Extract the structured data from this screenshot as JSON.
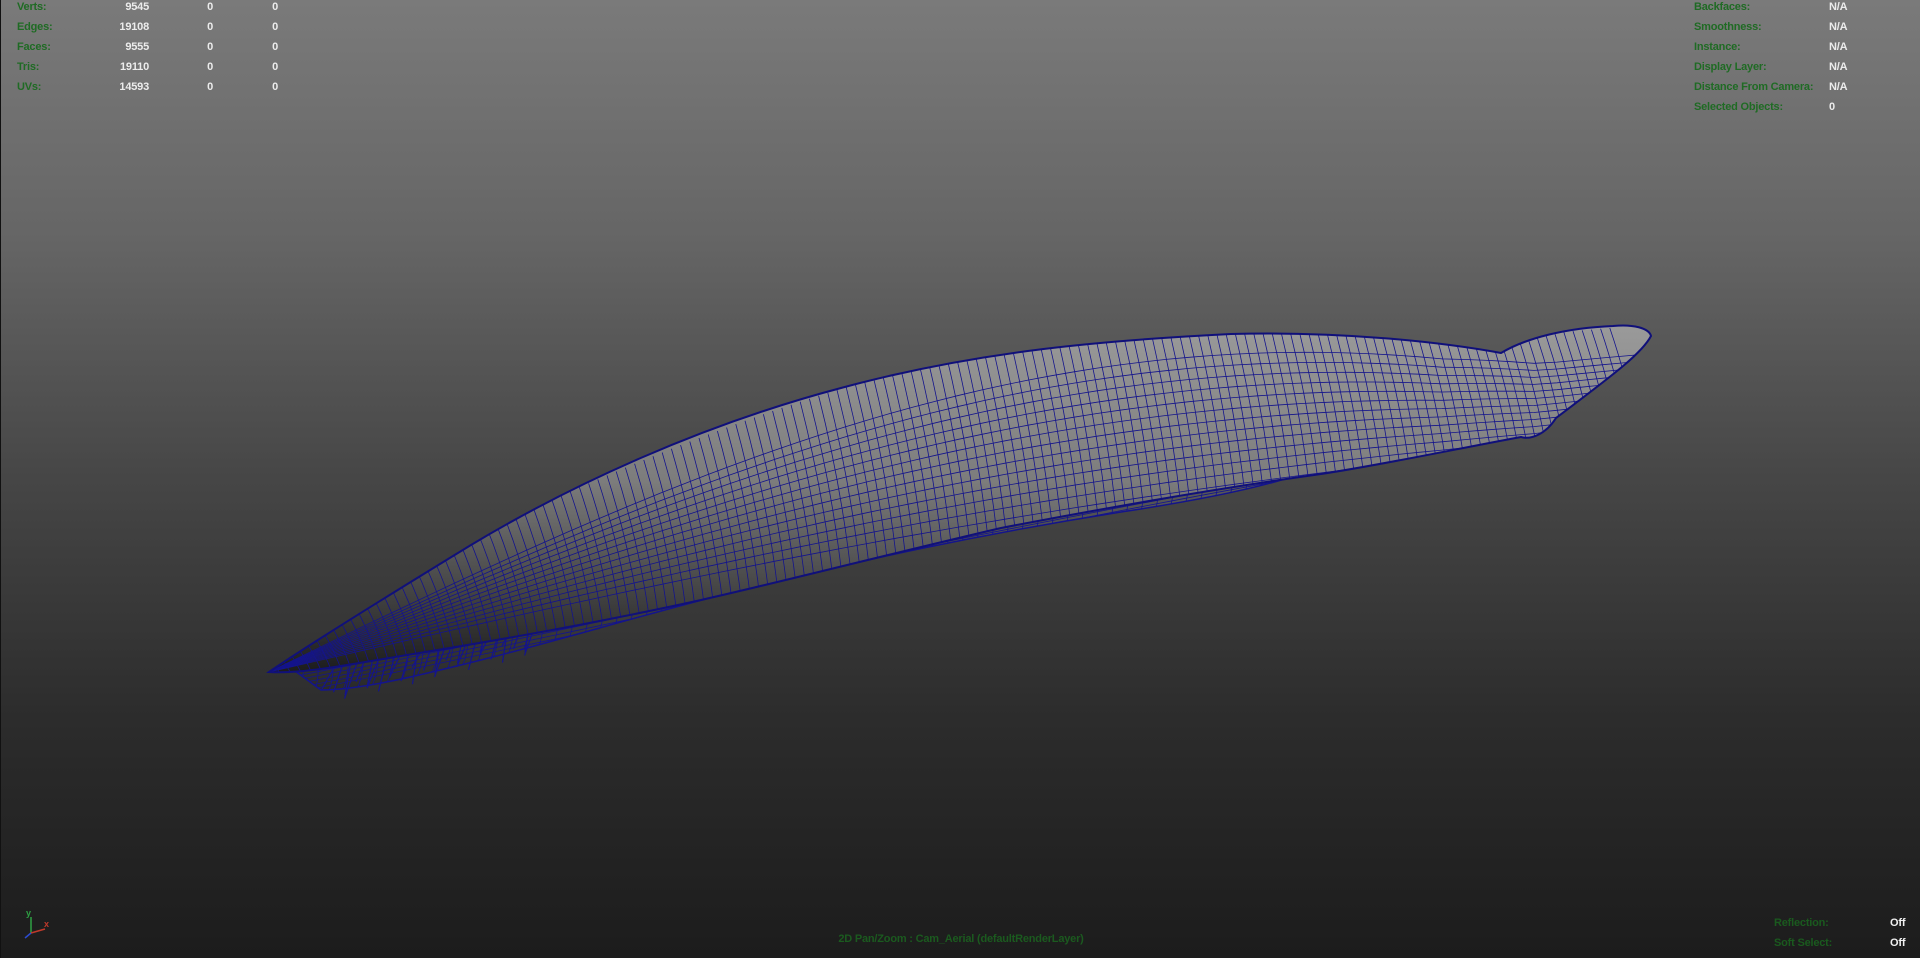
{
  "stats": {
    "rows": [
      {
        "label": "Verts:",
        "v1": "9545",
        "v2": "0",
        "v3": "0"
      },
      {
        "label": "Edges:",
        "v1": "19108",
        "v2": "0",
        "v3": "0"
      },
      {
        "label": "Faces:",
        "v1": "9555",
        "v2": "0",
        "v3": "0"
      },
      {
        "label": "Tris:",
        "v1": "19110",
        "v2": "0",
        "v3": "0"
      },
      {
        "label": "UVs:",
        "v1": "14593",
        "v2": "0",
        "v3": "0"
      }
    ]
  },
  "info": {
    "rows": [
      {
        "label": "Backfaces:",
        "value": "N/A"
      },
      {
        "label": "Smoothness:",
        "value": "N/A"
      },
      {
        "label": "Instance:",
        "value": "N/A"
      },
      {
        "label": "Display Layer:",
        "value": "N/A"
      },
      {
        "label": "Distance From Camera:",
        "value": "N/A"
      },
      {
        "label": "Selected Objects:",
        "value": "0"
      }
    ]
  },
  "camera_label": "2D Pan/Zoom : Cam_Aerial (defaultRenderLayer)",
  "bottom_right": {
    "rows": [
      {
        "label": "Reflection:",
        "value": "Off"
      },
      {
        "label": "Soft Select:",
        "value": "Off"
      }
    ]
  },
  "axis": {
    "y": "y",
    "x": "x"
  },
  "colors": {
    "wireframe": "#14148c",
    "hud_label": "#1f6b24",
    "hud_value": "#ececec",
    "axis_x": "#c0392b",
    "axis_y": "#2ea043",
    "axis_z": "#2b4bd0"
  }
}
